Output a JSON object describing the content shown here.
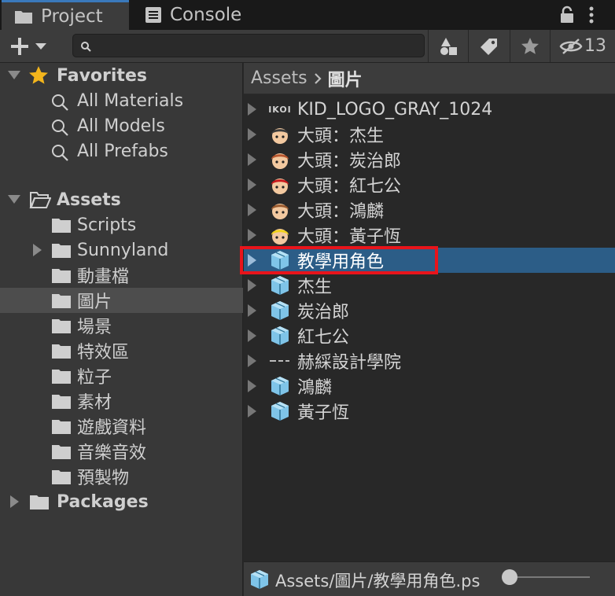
{
  "tabs": [
    {
      "label": "Project",
      "icon": "folder-icon",
      "active": true
    },
    {
      "label": "Console",
      "icon": "console-icon",
      "active": false
    }
  ],
  "toolbar": {
    "search_placeholder": "",
    "hidden_count": "13"
  },
  "favorites": {
    "label": "Favorites",
    "items": [
      {
        "label": "All Materials"
      },
      {
        "label": "All Models"
      },
      {
        "label": "All Prefabs"
      }
    ]
  },
  "assets": {
    "label": "Assets",
    "folders": [
      {
        "label": "Scripts",
        "expandable": false,
        "selected": false
      },
      {
        "label": "Sunnyland",
        "expandable": true,
        "selected": false
      },
      {
        "label": "動畫檔",
        "expandable": false,
        "selected": false
      },
      {
        "label": "圖片",
        "expandable": false,
        "selected": true
      },
      {
        "label": "場景",
        "expandable": false,
        "selected": false
      },
      {
        "label": "特效區",
        "expandable": false,
        "selected": false
      },
      {
        "label": "粒子",
        "expandable": false,
        "selected": false
      },
      {
        "label": "素材",
        "expandable": false,
        "selected": false
      },
      {
        "label": "遊戲資料",
        "expandable": false,
        "selected": false
      },
      {
        "label": "音樂音效",
        "expandable": false,
        "selected": false
      },
      {
        "label": "預製物",
        "expandable": false,
        "selected": false
      }
    ]
  },
  "packages": {
    "label": "Packages"
  },
  "breadcrumb": {
    "root": "Assets",
    "current": "圖片"
  },
  "asset_list": [
    {
      "label": "KID_LOGO_GRAY_1024",
      "icon": "logo-thumbnail-icon",
      "thumb_text": "IKOI",
      "selected": false
    },
    {
      "label": "大頭：杰生",
      "icon": "avatar-jiesheng-icon",
      "color": "#3a3a3a",
      "selected": false
    },
    {
      "label": "大頭：炭治郎",
      "icon": "avatar-tanjiro-icon",
      "color": "#b8562e",
      "selected": false
    },
    {
      "label": "大頭：紅七公",
      "icon": "avatar-hongqigong-icon",
      "color": "#c8161b",
      "selected": false
    },
    {
      "label": "大頭：鴻麟",
      "icon": "avatar-honglin-icon",
      "color": "#9a5a2e",
      "selected": false
    },
    {
      "label": "大頭：黃子恆",
      "icon": "avatar-huangziheng-icon",
      "color": "#f2d21a",
      "selected": false
    },
    {
      "label": "教學用角色",
      "icon": "prefab-cube-icon",
      "selected": true
    },
    {
      "label": "杰生",
      "icon": "prefab-cube-icon",
      "selected": false
    },
    {
      "label": "炭治郎",
      "icon": "prefab-cube-icon",
      "selected": false
    },
    {
      "label": "紅七公",
      "icon": "prefab-cube-icon",
      "selected": false
    },
    {
      "label": "赫綵設計學院",
      "icon": "logo-thumbnail-icon",
      "selected": false
    },
    {
      "label": "鴻麟",
      "icon": "prefab-cube-icon",
      "selected": false
    },
    {
      "label": "黃子恆",
      "icon": "prefab-cube-icon",
      "selected": false
    }
  ],
  "status": {
    "path": "Assets/圖片/教學用角色.ps"
  },
  "colors": {
    "accent_tab": "#3a79bb",
    "selection": "#2c5d87",
    "highlight_box": "#e8141b",
    "favorites_star": "#f3b51c",
    "cube": "#7fc4e8"
  }
}
